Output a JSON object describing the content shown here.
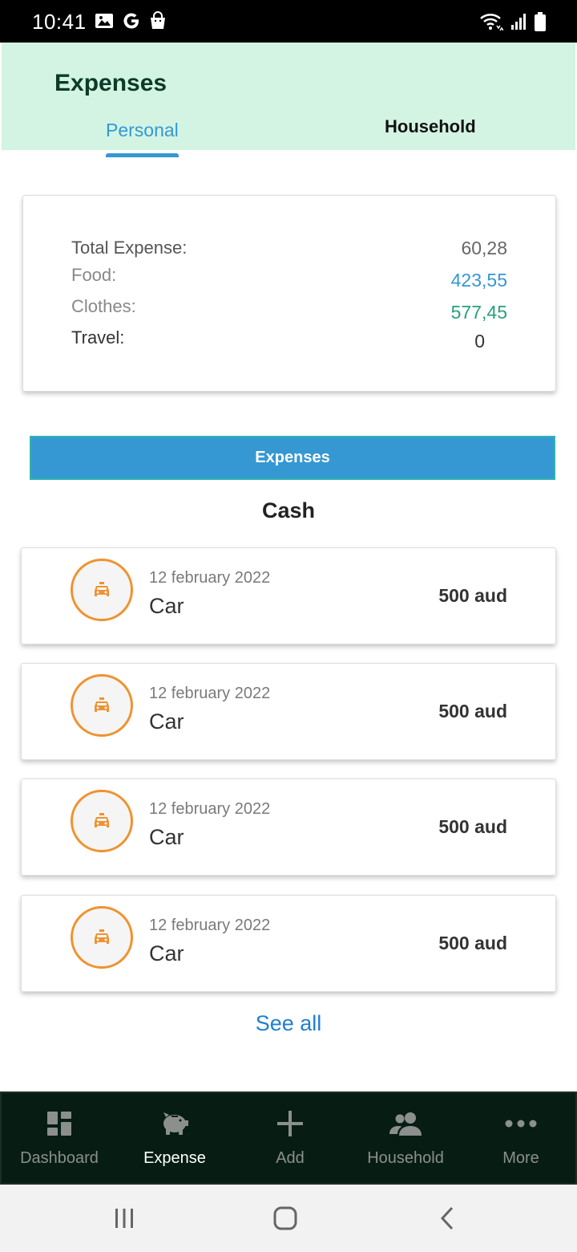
{
  "status_bar": {
    "time": "10:41"
  },
  "header": {
    "title": "Expenses",
    "tabs": [
      {
        "label": "Personal",
        "active": true
      },
      {
        "label": "Household",
        "active": false
      }
    ]
  },
  "summary": {
    "rows": [
      {
        "label": "Total Expense:",
        "value": "60,28",
        "label_color": "#555555",
        "value_color": "#666666"
      },
      {
        "label": "Food:",
        "value": "423,55",
        "label_color": "#888888",
        "value_color": "#3598d3"
      },
      {
        "label": "Clothes:",
        "value": "577,45",
        "label_color": "#888888",
        "value_color": "#27a07a"
      },
      {
        "label": "Travel:",
        "value": "0",
        "label_color": "#333333",
        "value_color": "#333333"
      }
    ]
  },
  "expenses_button": {
    "label": "Expenses"
  },
  "section": {
    "title": "Cash"
  },
  "transactions": [
    {
      "date": "12 february 2022",
      "name": "Car",
      "amount": "500 aud",
      "icon": "taxi-icon"
    },
    {
      "date": "12 february 2022",
      "name": "Car",
      "amount": "500 aud",
      "icon": "taxi-icon"
    },
    {
      "date": "12 february 2022",
      "name": "Car",
      "amount": "500 aud",
      "icon": "taxi-icon"
    },
    {
      "date": "12 february 2022",
      "name": "Car",
      "amount": "500 aud",
      "icon": "taxi-icon"
    }
  ],
  "see_all": {
    "label": "See all"
  },
  "bottom_nav": {
    "items": [
      {
        "label": "Dashboard",
        "icon": "dashboard-icon",
        "active": false
      },
      {
        "label": "Expense",
        "icon": "piggy-bank-icon",
        "active": true
      },
      {
        "label": "Add",
        "icon": "plus-icon",
        "active": false
      },
      {
        "label": "Household",
        "icon": "people-icon",
        "active": false
      },
      {
        "label": "More",
        "icon": "more-icon",
        "active": false
      }
    ]
  },
  "colors": {
    "accent": "#3598d3",
    "header_bg": "#d3f4e3",
    "nav_bg": "#071d14",
    "icon_orange": "#f0922f"
  }
}
